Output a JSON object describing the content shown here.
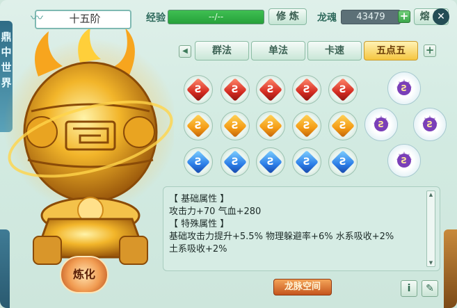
{
  "header": {
    "rank_title": "十五阶",
    "exp_label": "经验",
    "exp_value": "--/--",
    "cultivate_button": "修 炼",
    "soul_label": "龙魂",
    "soul_value": "43479",
    "smelt_button": "熔 炼",
    "plus_symbol": "+",
    "close_symbol": "✕"
  },
  "side": {
    "text": "鼎中世界"
  },
  "tabs": {
    "prev_arrow": "◀",
    "items": [
      {
        "label": "群法"
      },
      {
        "label": "单法"
      },
      {
        "label": "卡速"
      },
      {
        "label": "五点五"
      }
    ],
    "active_index": 3,
    "add_symbol": "+"
  },
  "gems": {
    "rows": [
      {
        "color": "red",
        "accent": "#d52c22",
        "count": 5
      },
      {
        "color": "orange",
        "accent": "#f49b14",
        "count": 5
      },
      {
        "color": "blue",
        "accent": "#2c7ee8",
        "count": 5
      }
    ],
    "stars": 4,
    "gem_glyph": "Ƨ"
  },
  "stats": {
    "base_header": "【 基础属性 】",
    "base_line": "攻击力+70  气血+280",
    "special_header": "【 特殊属性 】",
    "special_line1": "基础攻击力提升+5.5%  物理躲避率+6%  水系吸收+2%",
    "special_line2": "土系吸收+2%"
  },
  "footer": {
    "dragon_space_button": "龙脉空间",
    "info_icon": "i",
    "edit_icon": "✎",
    "refine_button": "炼化"
  },
  "colors": {
    "gold": "#f5c640",
    "green_bar": "#26a13a",
    "panel_bg": "#d3ebe2"
  }
}
